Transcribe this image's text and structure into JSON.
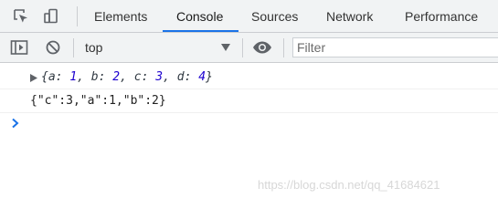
{
  "tabs": [
    {
      "label": "Elements",
      "active": false
    },
    {
      "label": "Console",
      "active": true
    },
    {
      "label": "Sources",
      "active": false
    },
    {
      "label": "Network",
      "active": false
    },
    {
      "label": "Performance",
      "active": false
    }
  ],
  "toolbar": {
    "context": "top",
    "filter_placeholder": "Filter"
  },
  "console": {
    "object_preview": {
      "open": "{",
      "entries": [
        {
          "key": "a",
          "value": "1"
        },
        {
          "key": "b",
          "value": "2"
        },
        {
          "key": "c",
          "value": "3"
        },
        {
          "key": "d",
          "value": "4"
        }
      ],
      "close": "}"
    },
    "json_string": "{\"c\":3,\"a\":1,\"b\":2}"
  },
  "watermark": "https://blog.csdn.net/qq_41684621",
  "colors": {
    "active_tab_underline": "#1a73e8",
    "number": "#1c00cf",
    "prompt": "#1a73e8"
  },
  "icons": [
    "inspect-element-icon",
    "device-toolbar-icon",
    "sidebar-toggle-icon",
    "clear-console-icon",
    "dropdown-arrow-icon",
    "eye-icon",
    "expand-triangle-icon",
    "prompt-chevron-icon"
  ]
}
